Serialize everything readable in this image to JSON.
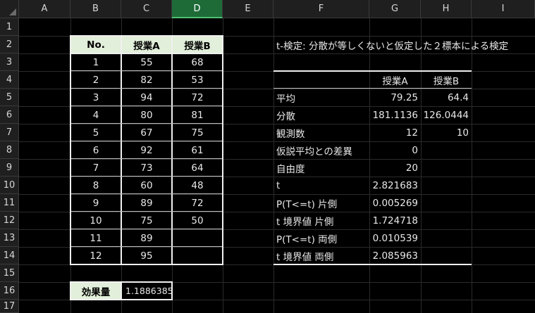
{
  "columns": [
    "A",
    "B",
    "C",
    "D",
    "E",
    "F",
    "G",
    "H",
    "I"
  ],
  "selected_column": "D",
  "rows": [
    "1",
    "2",
    "3",
    "4",
    "5",
    "6",
    "7",
    "8",
    "9",
    "10",
    "11",
    "12",
    "13",
    "14",
    "15",
    "16",
    "17"
  ],
  "data_table": {
    "headers": [
      "No.",
      "授業A",
      "授業B"
    ],
    "rows": [
      [
        "1",
        "55",
        "68"
      ],
      [
        "2",
        "82",
        "53"
      ],
      [
        "3",
        "94",
        "72"
      ],
      [
        "4",
        "80",
        "81"
      ],
      [
        "5",
        "67",
        "75"
      ],
      [
        "6",
        "92",
        "61"
      ],
      [
        "7",
        "73",
        "64"
      ],
      [
        "8",
        "60",
        "48"
      ],
      [
        "9",
        "89",
        "72"
      ],
      [
        "10",
        "75",
        "50"
      ],
      [
        "11",
        "89",
        ""
      ],
      [
        "12",
        "95",
        ""
      ]
    ]
  },
  "effect_size": {
    "label": "効果量",
    "value": "1.1886385"
  },
  "ttest": {
    "title": "t-検定: 分散が等しくないと仮定した２標本による検定",
    "col_headers": [
      "授業A",
      "授業B"
    ],
    "rows": [
      [
        "平均",
        "79.25",
        "64.4"
      ],
      [
        "分散",
        "181.1136",
        "126.0444"
      ],
      [
        "観測数",
        "12",
        "10"
      ],
      [
        "仮説平均との差異",
        "0",
        ""
      ],
      [
        "自由度",
        "20",
        ""
      ],
      [
        "t",
        "2.821683",
        ""
      ],
      [
        "P(T<=t) 片側",
        "0.005269",
        ""
      ],
      [
        "t 境界値 片側",
        "1.724718",
        ""
      ],
      [
        "P(T<=t) 両側",
        "0.010539",
        ""
      ],
      [
        "t 境界値 両側",
        "2.085963",
        ""
      ]
    ]
  }
}
